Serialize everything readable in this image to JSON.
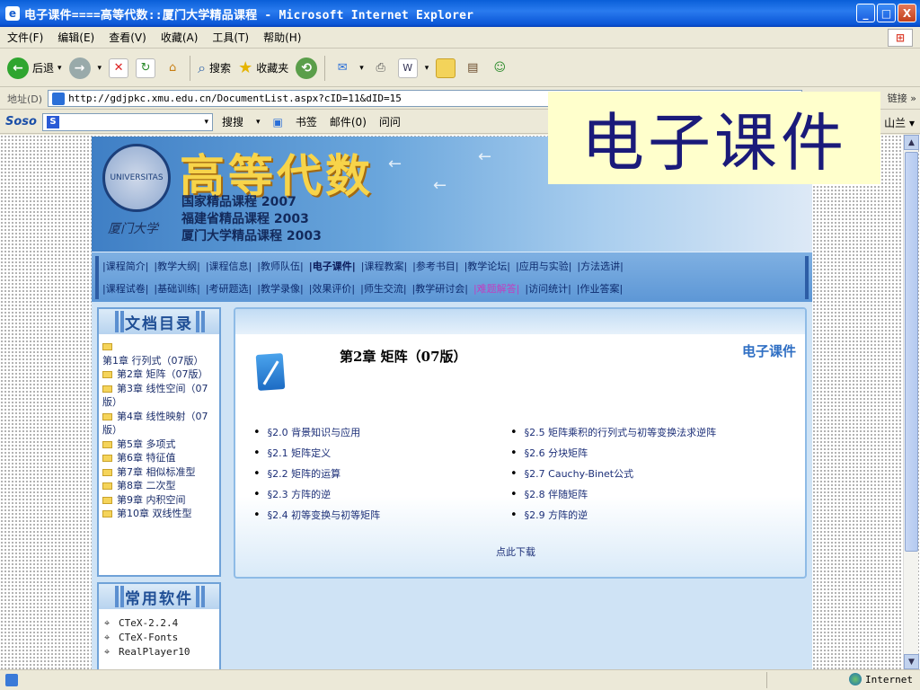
{
  "window": {
    "title": "电子课件====高等代数::厦门大学精品课程 - Microsoft Internet Explorer",
    "controls": {
      "minimize": "_",
      "maximize": "□",
      "close": "X"
    }
  },
  "menu": [
    "文件(F)",
    "编辑(E)",
    "查看(V)",
    "收藏(A)",
    "工具(T)",
    "帮助(H)"
  ],
  "toolbar": {
    "back": "后退",
    "search": "搜索",
    "favorites": "收藏夹"
  },
  "address": {
    "label": "地址(D)",
    "url": "http://gdjpkc.xmu.edu.cn/DocumentList.aspx?cID=11&dID=15",
    "links": "链接 »"
  },
  "soso": {
    "logo": "Soso",
    "search_btn": "搜搜",
    "bookmarks": "书签",
    "mail": "邮件(0)",
    "ask": "问问",
    "right": "山兰 ▾"
  },
  "overlay_label": "电子课件",
  "banner": {
    "title": "高等代数",
    "honors": [
      "国家精品课程 2007",
      "福建省精品课程 2003",
      "厦门大学精品课程 2003"
    ]
  },
  "nav": {
    "row1": [
      "|课程简介|",
      "|教学大纲|",
      "|课程信息|",
      "|教师队伍|",
      "|电子课件|",
      "|课程教案|",
      "|参考书目|",
      "|教学论坛|",
      "|应用与实验|",
      "|方法选讲|"
    ],
    "row2": [
      "|课程试卷|",
      "|基础训练|",
      "|考研题选|",
      "|教学录像|",
      "|效果评价|",
      "|师生交流|",
      "|教学研讨会|",
      "|难题解答|",
      "|访问统计|",
      "|作业答案|"
    ],
    "active": "|电子课件|"
  },
  "sidebar": {
    "toc_title": "文档目录",
    "toc": [
      "第1章 行列式（07版）",
      "第2章 矩阵（07版）",
      "第3章 线性空间（07版）",
      "第4章 线性映射（07版）",
      "第5章 多项式",
      "第6章 特征值",
      "第7章 相似标准型",
      "第8章 二次型",
      "第9章 内积空间",
      "第10章 双线性型"
    ],
    "software_title": "常用软件",
    "software": [
      "CTeX-2.2.4",
      "CTeX-Fonts",
      "RealPlayer10"
    ]
  },
  "main": {
    "tag": "电子课件",
    "chapter_title": "第2章 矩阵（07版）",
    "sections_left": [
      "§2.0 背景知识与应用",
      "§2.1 矩阵定义",
      "§2.2 矩阵的运算",
      "§2.3 方阵的逆",
      "§2.4 初等变换与初等矩阵"
    ],
    "sections_right": [
      "§2.5 矩阵乘积的行列式与初等变换法求逆阵",
      "§2.6 分块矩阵",
      "§2.7 Cauchy-Binet公式",
      "§2.8 伴随矩阵",
      "§2.9 方阵的逆"
    ],
    "download": "点此下载"
  },
  "status": {
    "zone": "Internet"
  }
}
